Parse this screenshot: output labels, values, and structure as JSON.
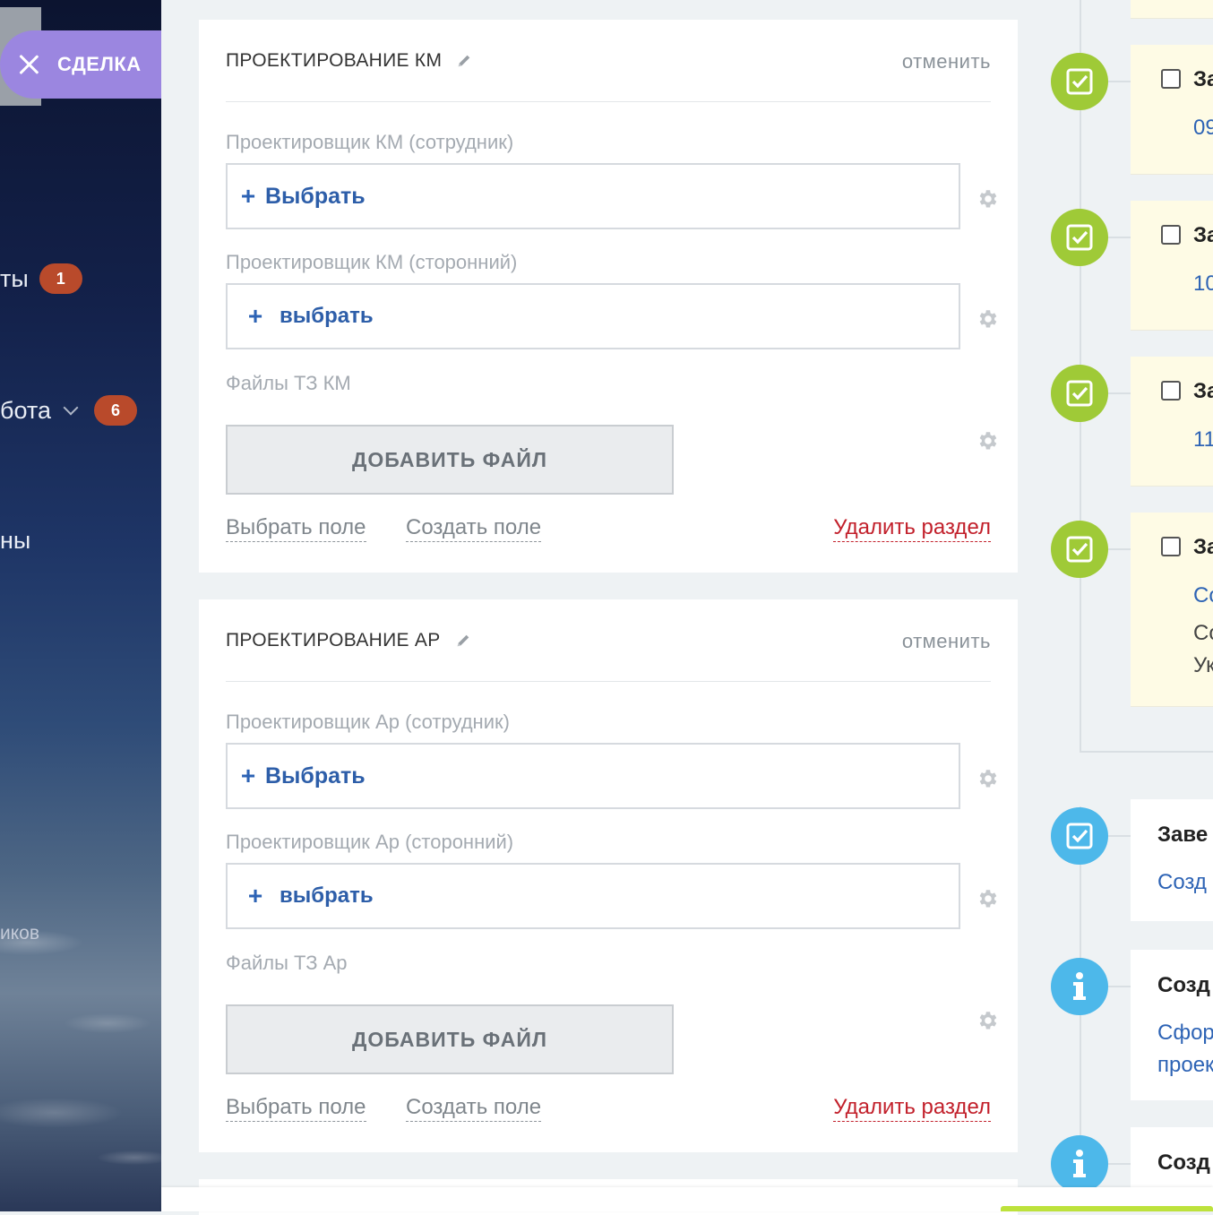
{
  "sidebar": {
    "deal_label": "СДЕЛКА",
    "items": [
      {
        "label": "ты",
        "badge": "1"
      },
      {
        "label": "бота",
        "badge": "6"
      },
      {
        "label": "ны"
      },
      {
        "label": "иков"
      }
    ]
  },
  "sections": [
    {
      "title": "ПРОЕКТИРОВАНИЕ КМ",
      "cancel": "отменить",
      "field1_label": "Проектировщик КМ (сотрудник)",
      "field1_button": "Выбрать",
      "field2_label": "Проектировщик КМ (сторонний)",
      "field2_button": "выбрать",
      "files_label": "Файлы ТЗ КМ",
      "add_file": "ДОБАВИТЬ ФАЙЛ",
      "select_field": "Выбрать поле",
      "create_field": "Создать поле",
      "delete_section": "Удалить раздел"
    },
    {
      "title": "ПРОЕКТИРОВАНИЕ АР",
      "cancel": "отменить",
      "field1_label": "Проектировщик Ар (сотрудник)",
      "field1_button": "Выбрать",
      "field2_label": "Проектировщик Ар (сторонний)",
      "field2_button": "выбрать",
      "files_label": "Файлы ТЗ Ар",
      "add_file": "ДОБАВИТЬ ФАЙЛ",
      "select_field": "Выбрать поле",
      "create_field": "Создать поле",
      "delete_section": "Удалить раздел"
    }
  ],
  "timeline": {
    "tasks": [
      {
        "title": "За",
        "date": "09"
      },
      {
        "title": "За",
        "date": "10"
      },
      {
        "title": "За",
        "date": "11"
      },
      {
        "title": "За",
        "link": "Со",
        "line1": "Со",
        "line2": "Ук"
      }
    ],
    "events": [
      {
        "title": "Заве",
        "link": "Созд"
      },
      {
        "title": "Созд",
        "link1": "Сфор",
        "link2": "проек"
      },
      {
        "title": "Созд"
      }
    ]
  },
  "colors": {
    "accent_blue": "#2d63b5",
    "danger_red": "#c2202b",
    "task_green": "#9fca37",
    "event_blue": "#4db8ea",
    "deal_purple": "#9b86e0",
    "badge_red": "#b94a2b"
  }
}
